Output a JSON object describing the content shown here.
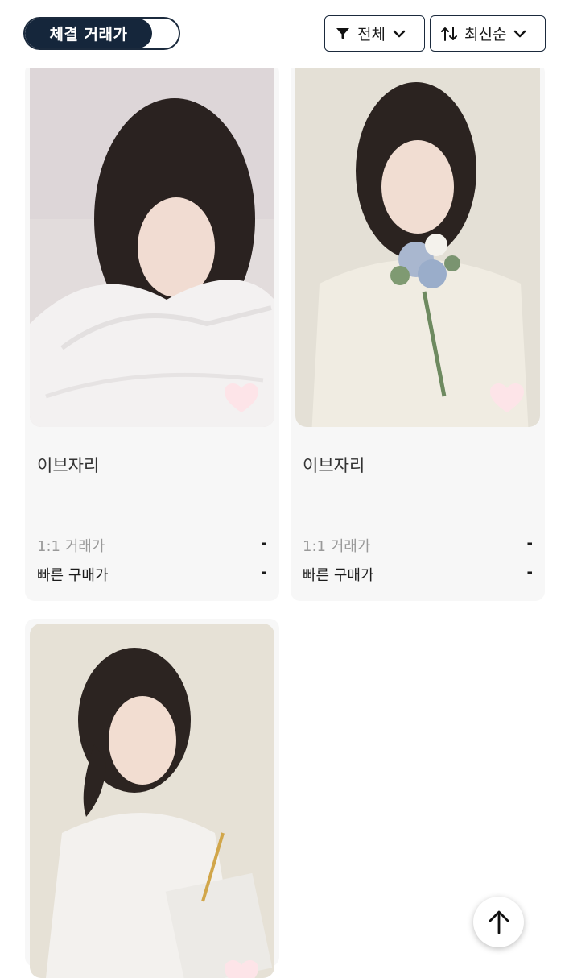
{
  "header": {
    "toggle_label": "체결 거래가",
    "filter": {
      "label": "전체",
      "icon": "filter-icon"
    },
    "sort": {
      "label": "최신순",
      "icon": "sort-arrows-icon"
    }
  },
  "cards": [
    {
      "name": "이브자리",
      "one_to_one_label": "1:1 거래가",
      "one_to_one_value": "-",
      "quick_buy_label": "빠른 구매가",
      "quick_buy_value": "-"
    },
    {
      "name": "이브자리",
      "one_to_one_label": "1:1 거래가",
      "one_to_one_value": "-",
      "quick_buy_label": "빠른 구매가",
      "quick_buy_value": "-"
    },
    {
      "name": "",
      "one_to_one_label": "",
      "one_to_one_value": "",
      "quick_buy_label": "",
      "quick_buy_value": ""
    }
  ],
  "scroll_top": {
    "icon": "arrow-up-icon"
  },
  "colors": {
    "navy": "#15263b",
    "heart": "#fde4e8",
    "card_bg": "#f7f7f7"
  }
}
